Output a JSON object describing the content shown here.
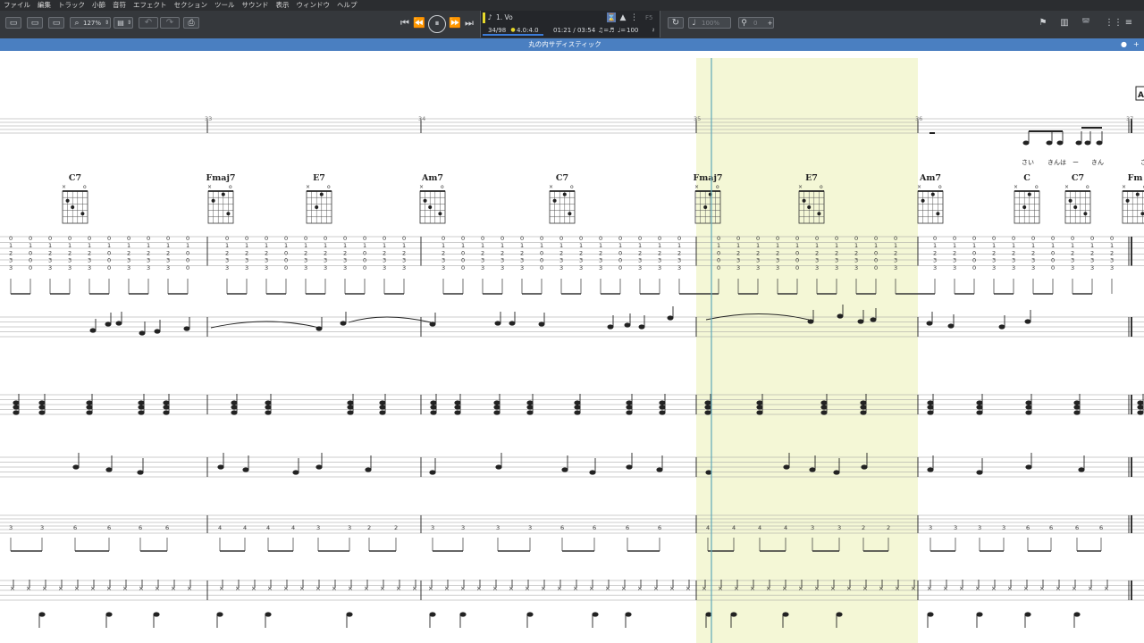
{
  "menu": [
    "ファイル",
    "編集",
    "トラック",
    "小節",
    "音符",
    "エフェクト",
    "セクション",
    "ツール",
    "サウンド",
    "表示",
    "ウィンドウ",
    "ヘルプ"
  ],
  "toolbar": {
    "zoom": "127%",
    "tempo": "100",
    "volume_percent": "100%",
    "velocity": "0",
    "key_label": "F5"
  },
  "transport": {
    "track_name": "1. Vo",
    "bar_position": "34/98",
    "time_signature": "4.0:4.0",
    "time": "01:21 / 03:54"
  },
  "document": {
    "title": "丸の内サディスティック"
  },
  "score": {
    "measure_numbers": [
      "33",
      "34",
      "35",
      "36",
      "37"
    ],
    "chords": [
      "C7",
      "Fmaj7",
      "E7",
      "Am7",
      "C7",
      "Fmaj7",
      "E7",
      "Am7",
      "C",
      "C7",
      "Fm"
    ],
    "lyrics": [
      "さい",
      "きん",
      "は",
      "ー",
      "きん",
      "さ"
    ],
    "rehearsal_mark": "A",
    "colors": {
      "selection": "#f4f7d6",
      "playhead": "#5fa8b8",
      "staff": "#9a9a9a"
    }
  }
}
